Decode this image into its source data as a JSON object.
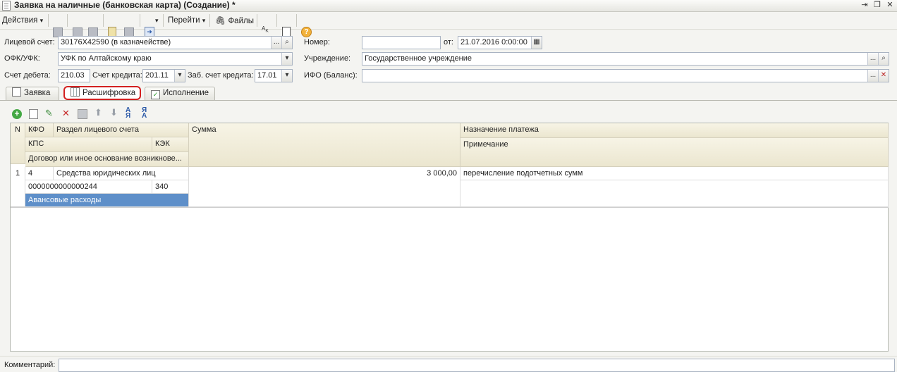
{
  "window": {
    "title": "Заявка на наличные (банковская карта) (Создание) *"
  },
  "toolbar": {
    "actions_label": "Действия",
    "goto_label": "Перейти",
    "files_label": "Файлы",
    "help_glyph": "?",
    "dropdown_glyph": "▾"
  },
  "form": {
    "account_label": "Лицевой счет:",
    "account_value": "30176X42590 (в казначействе)",
    "ofk_label": "ОФК/УФК:",
    "ofk_value": "УФК по Алтайскому краю",
    "debit_label": "Счет дебета:",
    "debit_value": "210.03",
    "credit_label": "Счет кредита:",
    "credit_value": "201.11",
    "offbalance_label": "Заб. счет кредита:",
    "offbalance_value": "17.01",
    "number_label": "Номер:",
    "number_value": "",
    "date_label": "от:",
    "date_value": "21.07.2016 0:00:00",
    "institution_label": "Учреждение:",
    "institution_value": "Государственное учреждение",
    "ifo_label": "ИФО (Баланс):",
    "ifo_value": "",
    "ellipsis": "...",
    "clear_glyph": "✕",
    "search_glyph": "⌕",
    "dropdown_glyph": "▾"
  },
  "tabs": [
    {
      "label": "Заявка"
    },
    {
      "label": "Расшифровка",
      "active": true
    },
    {
      "label": "Исполнение"
    }
  ],
  "grid": {
    "headers": {
      "n": "N",
      "kfo": "КФО",
      "section": "Раздел лицевого счета",
      "sum": "Сумма",
      "purpose": "Назначение платежа",
      "kps": "КПС",
      "kek": "КЭК",
      "contract": "Договор или иное основание возникнове...",
      "note": "Примечание"
    },
    "rows": [
      {
        "n": "1",
        "kfo": "4",
        "section": "Средства юридических лиц",
        "sum": "3 000,00",
        "purpose": "перечисление подотчетных сумм",
        "kps": "0000000000000244",
        "kek": "340",
        "contract": "Авансовые расходы",
        "note": ""
      }
    ]
  },
  "footer": {
    "comment_label": "Комментарий:",
    "comment_value": ""
  },
  "colors": {
    "accent_highlight": "#5e8fc9",
    "tab_outline": "#d32020"
  }
}
